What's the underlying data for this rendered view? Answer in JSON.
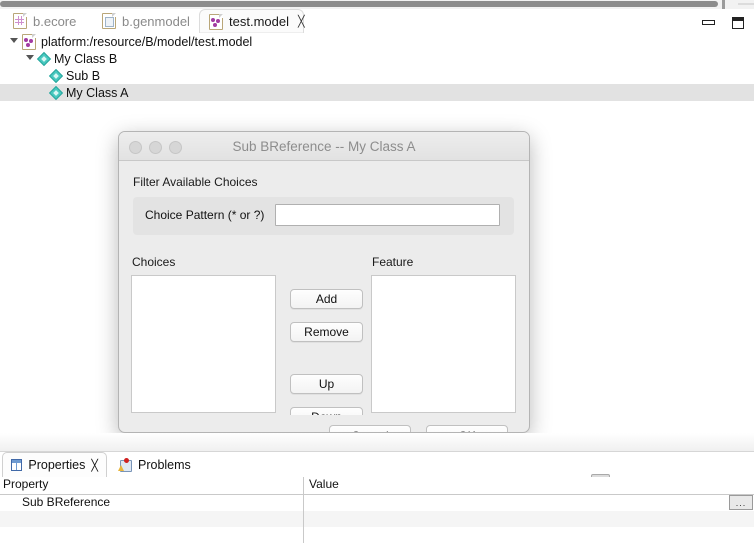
{
  "top_scrollbar": {
    "name": "horizontal-scrollbar"
  },
  "editor": {
    "tabs": [
      {
        "label": "b.ecore",
        "icon": "ecore-file-icon",
        "active": false,
        "closable": false
      },
      {
        "label": "b.genmodel",
        "icon": "genmodel-file-icon",
        "active": false,
        "closable": false
      },
      {
        "label": "test.model",
        "icon": "model-file-icon",
        "active": true,
        "closable": true,
        "close_glyph": "╳"
      }
    ],
    "tree": [
      {
        "label": "platform:/resource/B/model/test.model",
        "indent": 0,
        "twisty": true,
        "icon": "model-file-icon",
        "selected": false
      },
      {
        "label": "My Class B",
        "indent": 1,
        "twisty": true,
        "icon": "class-diamond-icon",
        "selected": false
      },
      {
        "label": "Sub B",
        "indent": 2,
        "twisty": false,
        "icon": "class-diamond-icon",
        "selected": false
      },
      {
        "label": "My Class A",
        "indent": 2,
        "twisty": false,
        "icon": "class-diamond-icon",
        "selected": true
      }
    ]
  },
  "window_controls": {
    "minimize": "minimize-icon",
    "maximize": "maximize-icon"
  },
  "dialog": {
    "title": "Sub BReference -- My Class A",
    "filter_section_label": "Filter Available Choices",
    "choice_pattern_label": "Choice Pattern (* or ?)",
    "choice_pattern_value": "",
    "choice_pattern_placeholder": "",
    "choices_label": "Choices",
    "feature_label": "Feature",
    "choices_items": [],
    "feature_items": [],
    "buttons": {
      "add": "Add",
      "remove": "Remove",
      "up": "Up",
      "down": "Down",
      "cancel": "Cancel",
      "ok": "OK"
    },
    "traffic_lights": [
      "close-button",
      "minimize-button",
      "zoom-button"
    ]
  },
  "bottom_panel": {
    "tabs": [
      {
        "label": "Properties",
        "icon": "properties-icon",
        "active": true,
        "closable": true,
        "close_glyph": "╳"
      },
      {
        "label": "Problems",
        "icon": "problems-icon",
        "active": false,
        "closable": false
      }
    ],
    "toolbar": [
      {
        "name": "new-properties-view-icon",
        "pressed": false
      },
      {
        "name": "show-categories-icon",
        "pressed": true
      },
      {
        "name": "show-advanced-properties-icon",
        "pressed": false
      },
      {
        "name": "restore-default-value-icon",
        "pressed": false
      },
      {
        "name": "pin-to-selection-icon",
        "pressed": false
      },
      {
        "name": "view-menu-icon",
        "pressed": false
      },
      {
        "name": "minimize-view-icon",
        "pressed": false
      },
      {
        "name": "maximize-view-icon",
        "pressed": false
      }
    ],
    "table": {
      "columns": [
        "Property",
        "Value"
      ],
      "rows": [
        {
          "property": "Sub BReference",
          "value": "",
          "has_ellipsis_button": true
        },
        {
          "property": "",
          "value": "",
          "has_ellipsis_button": false
        },
        {
          "property": "",
          "value": "",
          "has_ellipsis_button": false
        }
      ],
      "ellipsis_label": "..."
    }
  },
  "colors": {
    "selection": "#e2e2e2",
    "dialog_bg": "#ececec",
    "accent_diamond": "#47c8bf",
    "alt_row": "#f5f5f5"
  }
}
